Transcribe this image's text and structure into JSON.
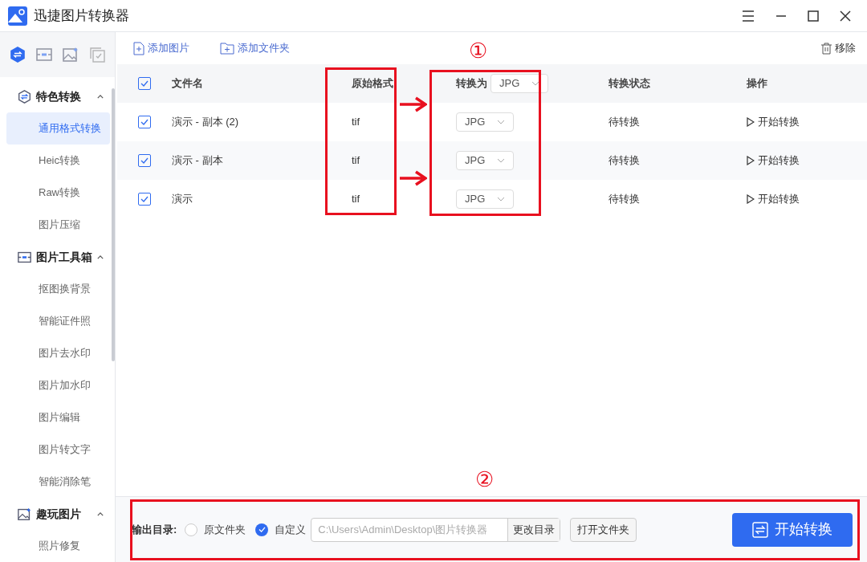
{
  "window": {
    "title": "迅捷图片转换器"
  },
  "sidebar": {
    "tabs": [
      {
        "kind": "convert",
        "selected": true
      },
      {
        "kind": "toolbox",
        "selected": false
      },
      {
        "kind": "image",
        "selected": false
      },
      {
        "kind": "copy",
        "selected": false
      }
    ],
    "groups": [
      {
        "kind": "convert",
        "label": "特色转换",
        "expanded": true,
        "items": [
          {
            "label": "通用格式转换",
            "selected": true
          },
          {
            "label": "Heic转换",
            "selected": false
          },
          {
            "label": "Raw转换",
            "selected": false
          },
          {
            "label": "图片压缩",
            "selected": false
          }
        ]
      },
      {
        "kind": "toolbox",
        "label": "图片工具箱",
        "expanded": true,
        "items": [
          {
            "label": "抠图换背景",
            "selected": false
          },
          {
            "label": "智能证件照",
            "selected": false
          },
          {
            "label": "图片去水印",
            "selected": false
          },
          {
            "label": "图片加水印",
            "selected": false
          },
          {
            "label": "图片编辑",
            "selected": false
          },
          {
            "label": "图片转文字",
            "selected": false
          },
          {
            "label": "智能消除笔",
            "selected": false
          }
        ]
      },
      {
        "kind": "image",
        "label": "趣玩图片",
        "expanded": true,
        "items": [
          {
            "label": "照片修复",
            "selected": false
          }
        ]
      }
    ]
  },
  "toolbar": {
    "add_image": "添加图片",
    "add_folder": "添加文件夹",
    "remove": "移除"
  },
  "table": {
    "select_all": true,
    "columns": [
      "文件名",
      "原始格式",
      "转换为",
      "转换状态",
      "操作"
    ],
    "header_format": "JPG",
    "rows": [
      {
        "checked": true,
        "name": "演示 - 副本 (2)",
        "format": "tif",
        "target": "JPG",
        "status": "待转换",
        "action": "开始转换"
      },
      {
        "checked": true,
        "name": "演示 - 副本",
        "format": "tif",
        "target": "JPG",
        "status": "待转换",
        "action": "开始转换"
      },
      {
        "checked": true,
        "name": "演示",
        "format": "tif",
        "target": "JPG",
        "status": "待转换",
        "action": "开始转换"
      }
    ]
  },
  "output": {
    "label": "输出目录:",
    "options": [
      {
        "label": "原文件夹",
        "selected": false
      },
      {
        "label": "自定义",
        "selected": true
      }
    ],
    "path": "C:\\Users\\Admin\\Desktop\\图片转换器",
    "change_button": "更改目录",
    "open_button": "打开文件夹",
    "start_button": "开始转换"
  },
  "annotations": [
    "①",
    "②"
  ]
}
